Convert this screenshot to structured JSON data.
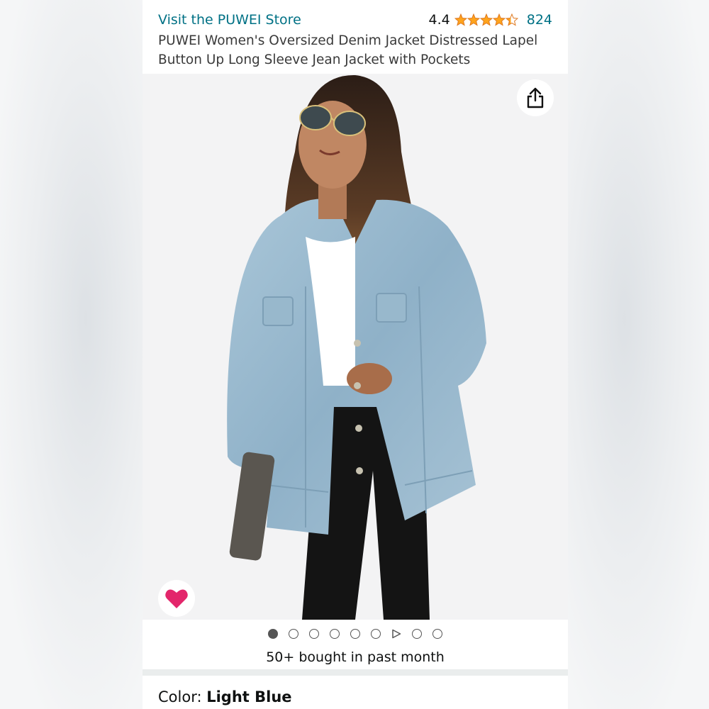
{
  "product": {
    "store_link": "Visit the PUWEI Store",
    "rating_value": "4.4",
    "rating_stars": 4.4,
    "rating_count": "824",
    "title": "PUWEI Women's Oversized Denim Jacket Distressed Lapel Button Up Long Sleeve Jean Jacket with Pockets",
    "bought_text": "50+ bought in past month",
    "color_label": "Color: ",
    "color_value": "Light Blue"
  },
  "gallery": {
    "image_count": 9,
    "active_index": 0,
    "video_index": 6
  },
  "colors": {
    "link": "#007185",
    "star": "#FFA41C",
    "heart": "#E3266B"
  },
  "icons": {
    "share": "share-icon",
    "favorite": "heart-icon",
    "star": "star-icon",
    "play": "play-icon"
  }
}
